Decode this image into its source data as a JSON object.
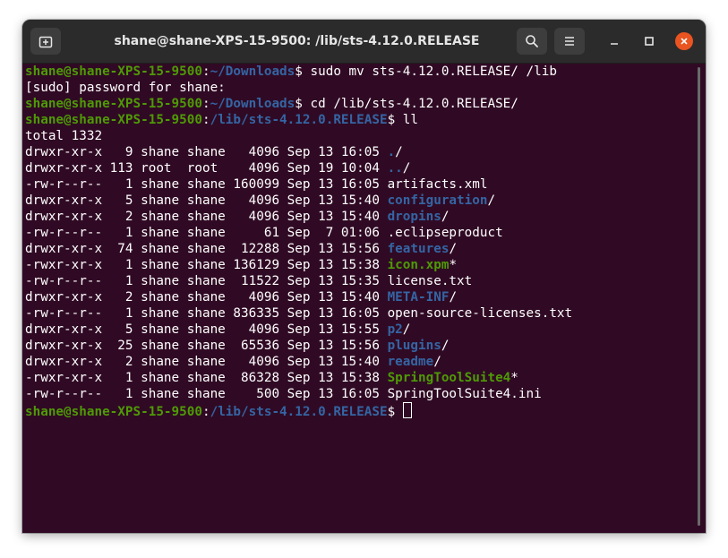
{
  "window": {
    "title": "shane@shane-XPS-15-9500: /lib/sts-4.12.0.RELEASE"
  },
  "titlebar_icons": {
    "new_tab": "new-tab-icon",
    "search": "search-icon",
    "menu": "hamburger-menu-icon",
    "minimize": "minimize-icon",
    "maximize": "maximize-icon",
    "close": "close-icon"
  },
  "colors": {
    "background": "#300a24",
    "prompt_user": "#4e9a06",
    "prompt_path": "#3465a4",
    "directory": "#3465a4",
    "executable": "#4e9a06",
    "close_button": "#e95420"
  },
  "terminal": {
    "prompt_user": "shane@shane-XPS-15-9500",
    "sudo_prompt": "[sudo] password for shane:",
    "total": "total 1332",
    "commands": [
      {
        "path": "~/Downloads",
        "command": " sudo mv sts-4.12.0.RELEASE/ /lib"
      },
      {
        "path": "~/Downloads",
        "command": " cd /lib/sts-4.12.0.RELEASE/"
      },
      {
        "path": "/lib/sts-4.12.0.RELEASE",
        "command": " ll"
      },
      {
        "path": "/lib/sts-4.12.0.RELEASE",
        "command": " "
      }
    ],
    "listing": [
      {
        "meta": "drwxr-xr-x   9 shane shane   4096 Sep 13 16:05 ",
        "name": ".",
        "suffix": "/",
        "kind": "dir"
      },
      {
        "meta": "drwxr-xr-x 113 root  root    4096 Sep 19 10:04 ",
        "name": "..",
        "suffix": "/",
        "kind": "dir"
      },
      {
        "meta": "-rw-r--r--   1 shane shane 160099 Sep 13 16:05 ",
        "name": "artifacts.xml",
        "suffix": "",
        "kind": "file"
      },
      {
        "meta": "drwxr-xr-x   5 shane shane   4096 Sep 13 15:40 ",
        "name": "configuration",
        "suffix": "/",
        "kind": "dir"
      },
      {
        "meta": "drwxr-xr-x   2 shane shane   4096 Sep 13 15:40 ",
        "name": "dropins",
        "suffix": "/",
        "kind": "dir"
      },
      {
        "meta": "-rw-r--r--   1 shane shane     61 Sep  7 01:06 ",
        "name": ".eclipseproduct",
        "suffix": "",
        "kind": "file"
      },
      {
        "meta": "drwxr-xr-x  74 shane shane  12288 Sep 13 15:56 ",
        "name": "features",
        "suffix": "/",
        "kind": "dir"
      },
      {
        "meta": "-rwxr-xr-x   1 shane shane 136129 Sep 13 15:38 ",
        "name": "icon.xpm",
        "suffix": "*",
        "kind": "exe"
      },
      {
        "meta": "-rw-r--r--   1 shane shane  11522 Sep 13 15:35 ",
        "name": "license.txt",
        "suffix": "",
        "kind": "file"
      },
      {
        "meta": "drwxr-xr-x   2 shane shane   4096 Sep 13 15:40 ",
        "name": "META-INF",
        "suffix": "/",
        "kind": "dir"
      },
      {
        "meta": "-rw-r--r--   1 shane shane 836335 Sep 13 16:05 ",
        "name": "open-source-licenses.txt",
        "suffix": "",
        "kind": "file"
      },
      {
        "meta": "drwxr-xr-x   5 shane shane   4096 Sep 13 15:55 ",
        "name": "p2",
        "suffix": "/",
        "kind": "dir"
      },
      {
        "meta": "drwxr-xr-x  25 shane shane  65536 Sep 13 15:56 ",
        "name": "plugins",
        "suffix": "/",
        "kind": "dir"
      },
      {
        "meta": "drwxr-xr-x   2 shane shane   4096 Sep 13 15:40 ",
        "name": "readme",
        "suffix": "/",
        "kind": "dir"
      },
      {
        "meta": "-rwxr-xr-x   1 shane shane  86328 Sep 13 15:38 ",
        "name": "SpringToolSuite4",
        "suffix": "*",
        "kind": "exe"
      },
      {
        "meta": "-rw-r--r--   1 shane shane    500 Sep 13 16:05 ",
        "name": "SpringToolSuite4.ini",
        "suffix": "",
        "kind": "file"
      }
    ]
  }
}
